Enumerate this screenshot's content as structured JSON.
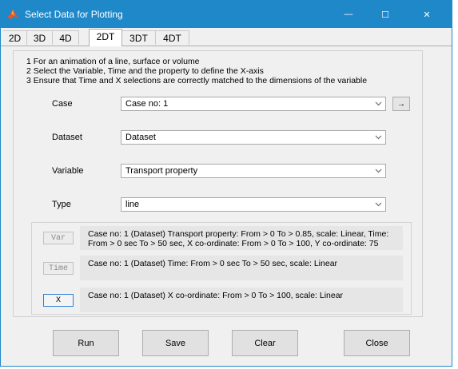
{
  "window": {
    "title": "Select Data for Plotting",
    "controls": {
      "minimize": "—",
      "maximize": "☐",
      "close": "✕"
    }
  },
  "tabs": [
    "2D",
    "3D",
    "4D",
    "2DT",
    "3DT",
    "4DT"
  ],
  "active_tab": "2DT",
  "instructions": [
    "1 For an animation of a line, surface or volume",
    "2 Select the Variable, Time and the property to define the X-axis",
    "3 Ensure that Time and X selections are correctly matched to the dimensions of the variable"
  ],
  "fields": {
    "case": {
      "label": "Case",
      "value": "Case no: 1"
    },
    "dataset": {
      "label": "Dataset",
      "value": "Dataset"
    },
    "variable": {
      "label": "Variable",
      "value": "Transport property"
    },
    "type": {
      "label": "Type",
      "value": "line"
    }
  },
  "arrow_button": "→",
  "info": {
    "var": {
      "button": "Var",
      "text_line1": "Case no: 1 (Dataset) Transport property: From > 0 To > 0.85, scale: Linear, Time:",
      "text_line2": "From > 0 sec To > 50 sec, X co-ordinate: From > 0 To > 100, Y co-ordinate: 75"
    },
    "time": {
      "button": "Time",
      "text": "Case no: 1 (Dataset) Time: From > 0 sec To > 50 sec, scale: Linear"
    },
    "x": {
      "button": "X",
      "text": "Case no: 1 (Dataset) X co-ordinate: From > 0 To > 100, scale: Linear"
    }
  },
  "actions": {
    "run": "Run",
    "save": "Save",
    "clear": "Clear",
    "close": "Close"
  },
  "icons": {
    "app": "matlab-logo-icon",
    "dropdown": "chevron-down-icon"
  },
  "colors": {
    "titlebar": "#1e88c9",
    "selected_border": "#2f7fd0"
  }
}
